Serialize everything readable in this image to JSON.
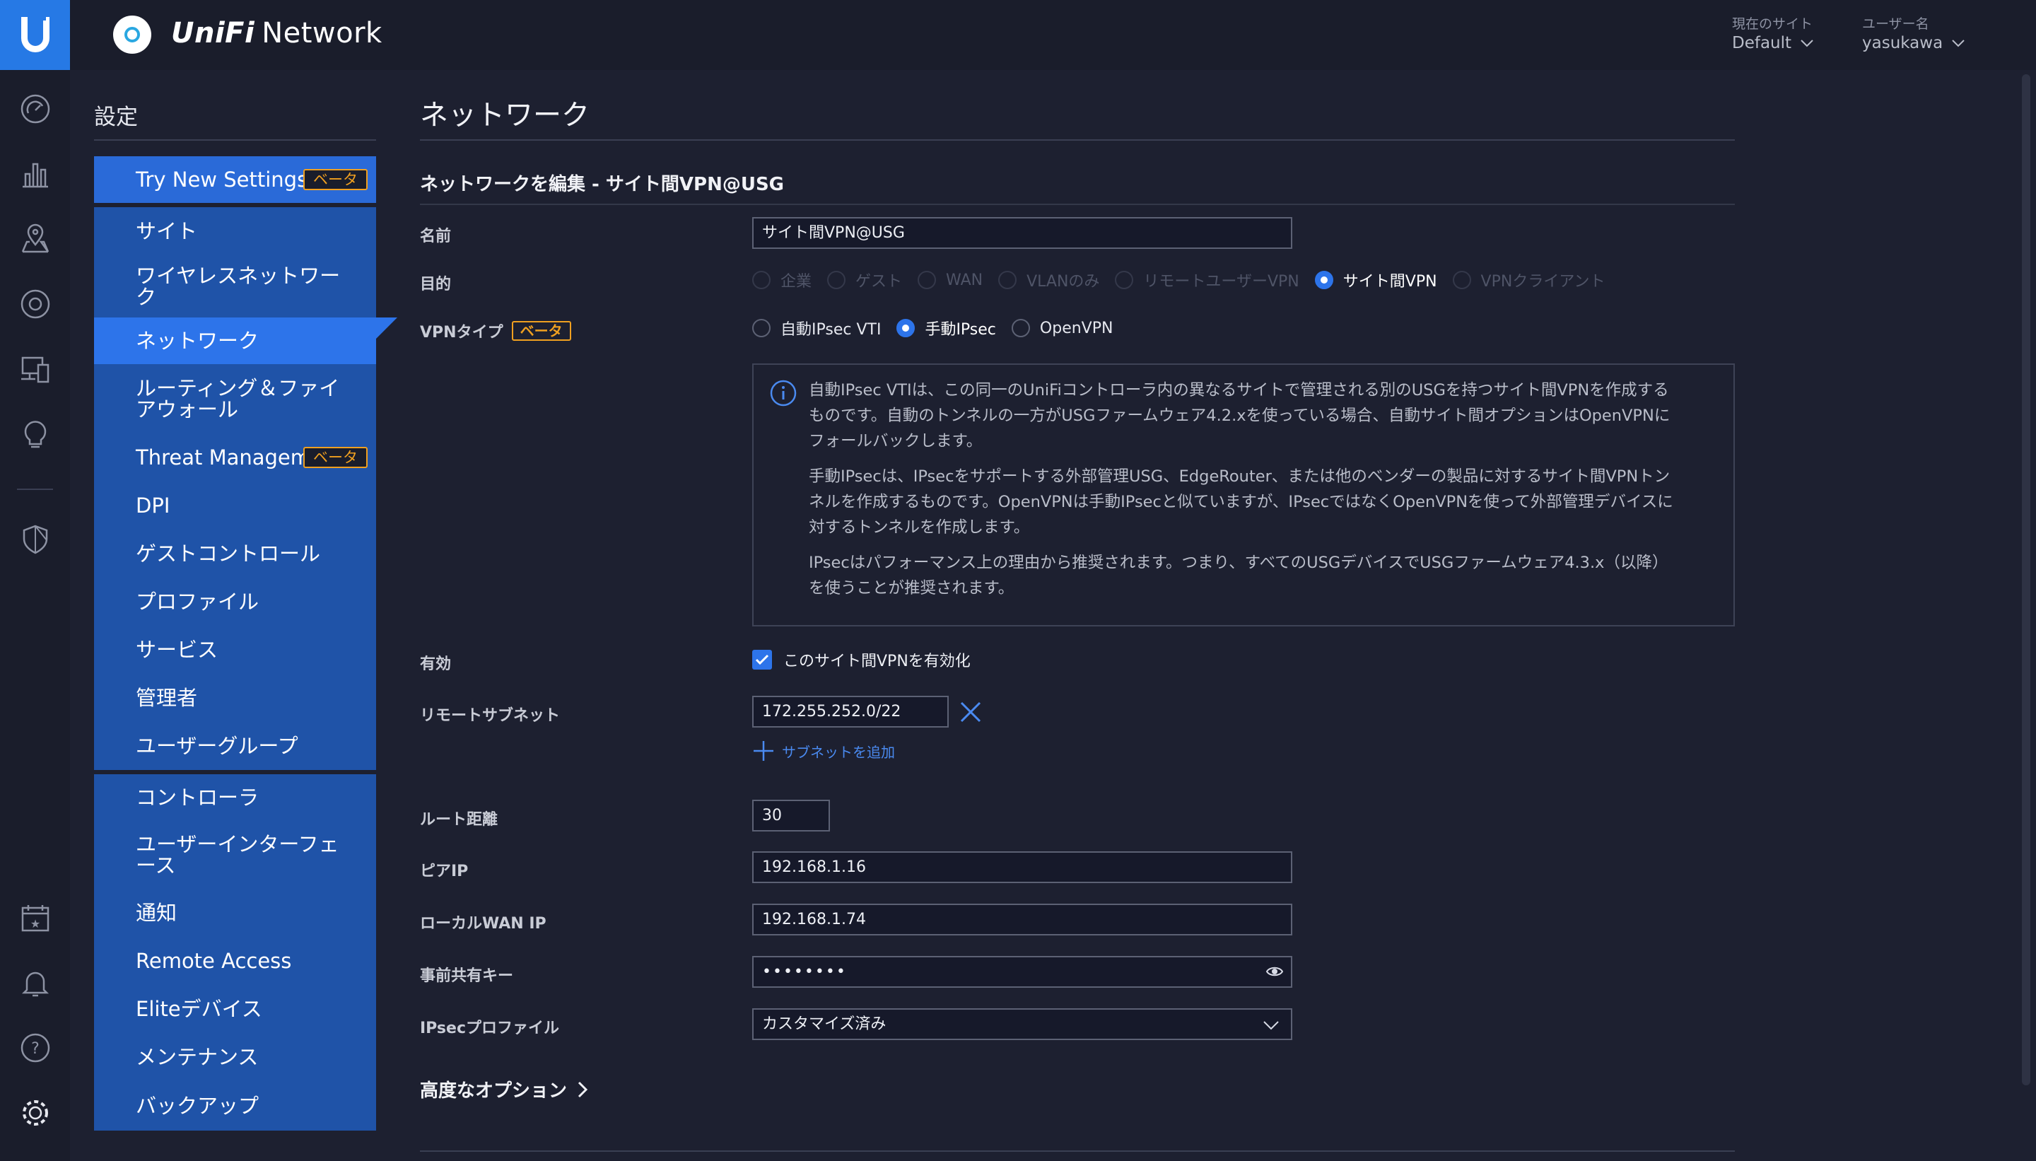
{
  "header": {
    "brand": "UniFi",
    "app_name": "Network",
    "site_label": "現在のサイト",
    "site_value": "Default",
    "user_label": "ユーザー名",
    "user_value": "yasukawa"
  },
  "rail_icons": [
    "dashboard-icon",
    "statistics-icon",
    "map-icon",
    "devices-icon",
    "clients-icon",
    "insights-icon",
    "threat-shield-icon",
    "events-calendar-icon",
    "alerts-bell-icon",
    "help-icon",
    "settings-gear-icon"
  ],
  "sidebar": {
    "title": "設定",
    "try_new": {
      "label": "Try New Settings",
      "badge": "ベータ"
    },
    "group1": [
      {
        "label": "サイト"
      },
      {
        "label": "ワイヤレスネットワー",
        "label2": "ク"
      },
      {
        "label": "ネットワーク"
      },
      {
        "label": "ルーティング＆ファイ",
        "label2": "アウォール"
      },
      {
        "label": "Threat Management",
        "badge": "ベータ"
      },
      {
        "label": "DPI"
      },
      {
        "label": "ゲストコントロール"
      },
      {
        "label": "プロファイル"
      },
      {
        "label": "サービス"
      },
      {
        "label": "管理者"
      },
      {
        "label": "ユーザーグループ"
      }
    ],
    "group2": [
      {
        "label": "コントローラ"
      },
      {
        "label": "ユーザーインターフェ",
        "label2": "ース"
      },
      {
        "label": "通知"
      },
      {
        "label": "Remote Access"
      },
      {
        "label": "Eliteデバイス"
      },
      {
        "label": "メンテナンス"
      },
      {
        "label": "バックアップ"
      }
    ]
  },
  "main": {
    "page_title": "ネットワーク",
    "section_title": "ネットワークを編集 - サイト間VPN@USG",
    "name_label": "名前",
    "name_value": "サイト間VPN@USG",
    "purpose_label": "目的",
    "purpose_options": [
      "企業",
      "ゲスト",
      "WAN",
      "VLANのみ",
      "リモートユーザーVPN",
      "サイト間VPN",
      "VPNクライアント"
    ],
    "purpose_selected": "サイト間VPN",
    "vpn_type_label": "VPNタイプ",
    "vpn_type_badge": "ベータ",
    "vpn_type_options": [
      "自動IPsec VTI",
      "手動IPsec",
      "OpenVPN"
    ],
    "vpn_type_selected": "手動IPsec",
    "info": {
      "p1a": "自動IPsec VTIは、この同一のUniFiコントローラ内の異なるサイトで管理される別のUSGを持つサイト間VPNを作成する",
      "p1b": "ものです。自動のトンネルの一方がUSGファームウェア4.2.xを使っている場合、自動サイト間オプションはOpenVPNに",
      "p1c": "フォールバックします。",
      "p2a": "手動IPsecは、IPsecをサポートする外部管理USG、EdgeRouter、または他のベンダーの製品に対するサイト間VPNトン",
      "p2b": "ネルを作成するものです。OpenVPNは手動IPsecと似ていますが、IPsecではなくOpenVPNを使って外部管理デバイスに",
      "p2c": "対するトンネルを作成します。",
      "p3a": "IPsecはパフォーマンス上の理由から推奨されます。つまり、すべてのUSGデバイスでUSGファームウェア4.3.x（以降）",
      "p3b": "を使うことが推奨されます。"
    },
    "enabled_label": "有効",
    "enabled_checkbox": "このサイト間VPNを有効化",
    "remote_subnet_label": "リモートサブネット",
    "remote_subnet_value": "172.255.252.0/22",
    "add_subnet": "サブネットを追加",
    "route_distance_label": "ルート距離",
    "route_distance_value": "30",
    "peer_ip_label": "ピアIP",
    "peer_ip_value": "192.168.1.16",
    "local_wan_label": "ローカルWAN IP",
    "local_wan_value": "192.168.1.74",
    "psk_label": "事前共有キー",
    "psk_value": "••••••••",
    "ipsec_profile_label": "IPsecプロファイル",
    "ipsec_profile_value": "カスタマイズ済み",
    "advanced": "高度なオプション"
  },
  "colors": {
    "accent": "#2d74ea",
    "beta": "#f0a020",
    "bg": "#1d2030",
    "nav": "#1f53a8"
  }
}
